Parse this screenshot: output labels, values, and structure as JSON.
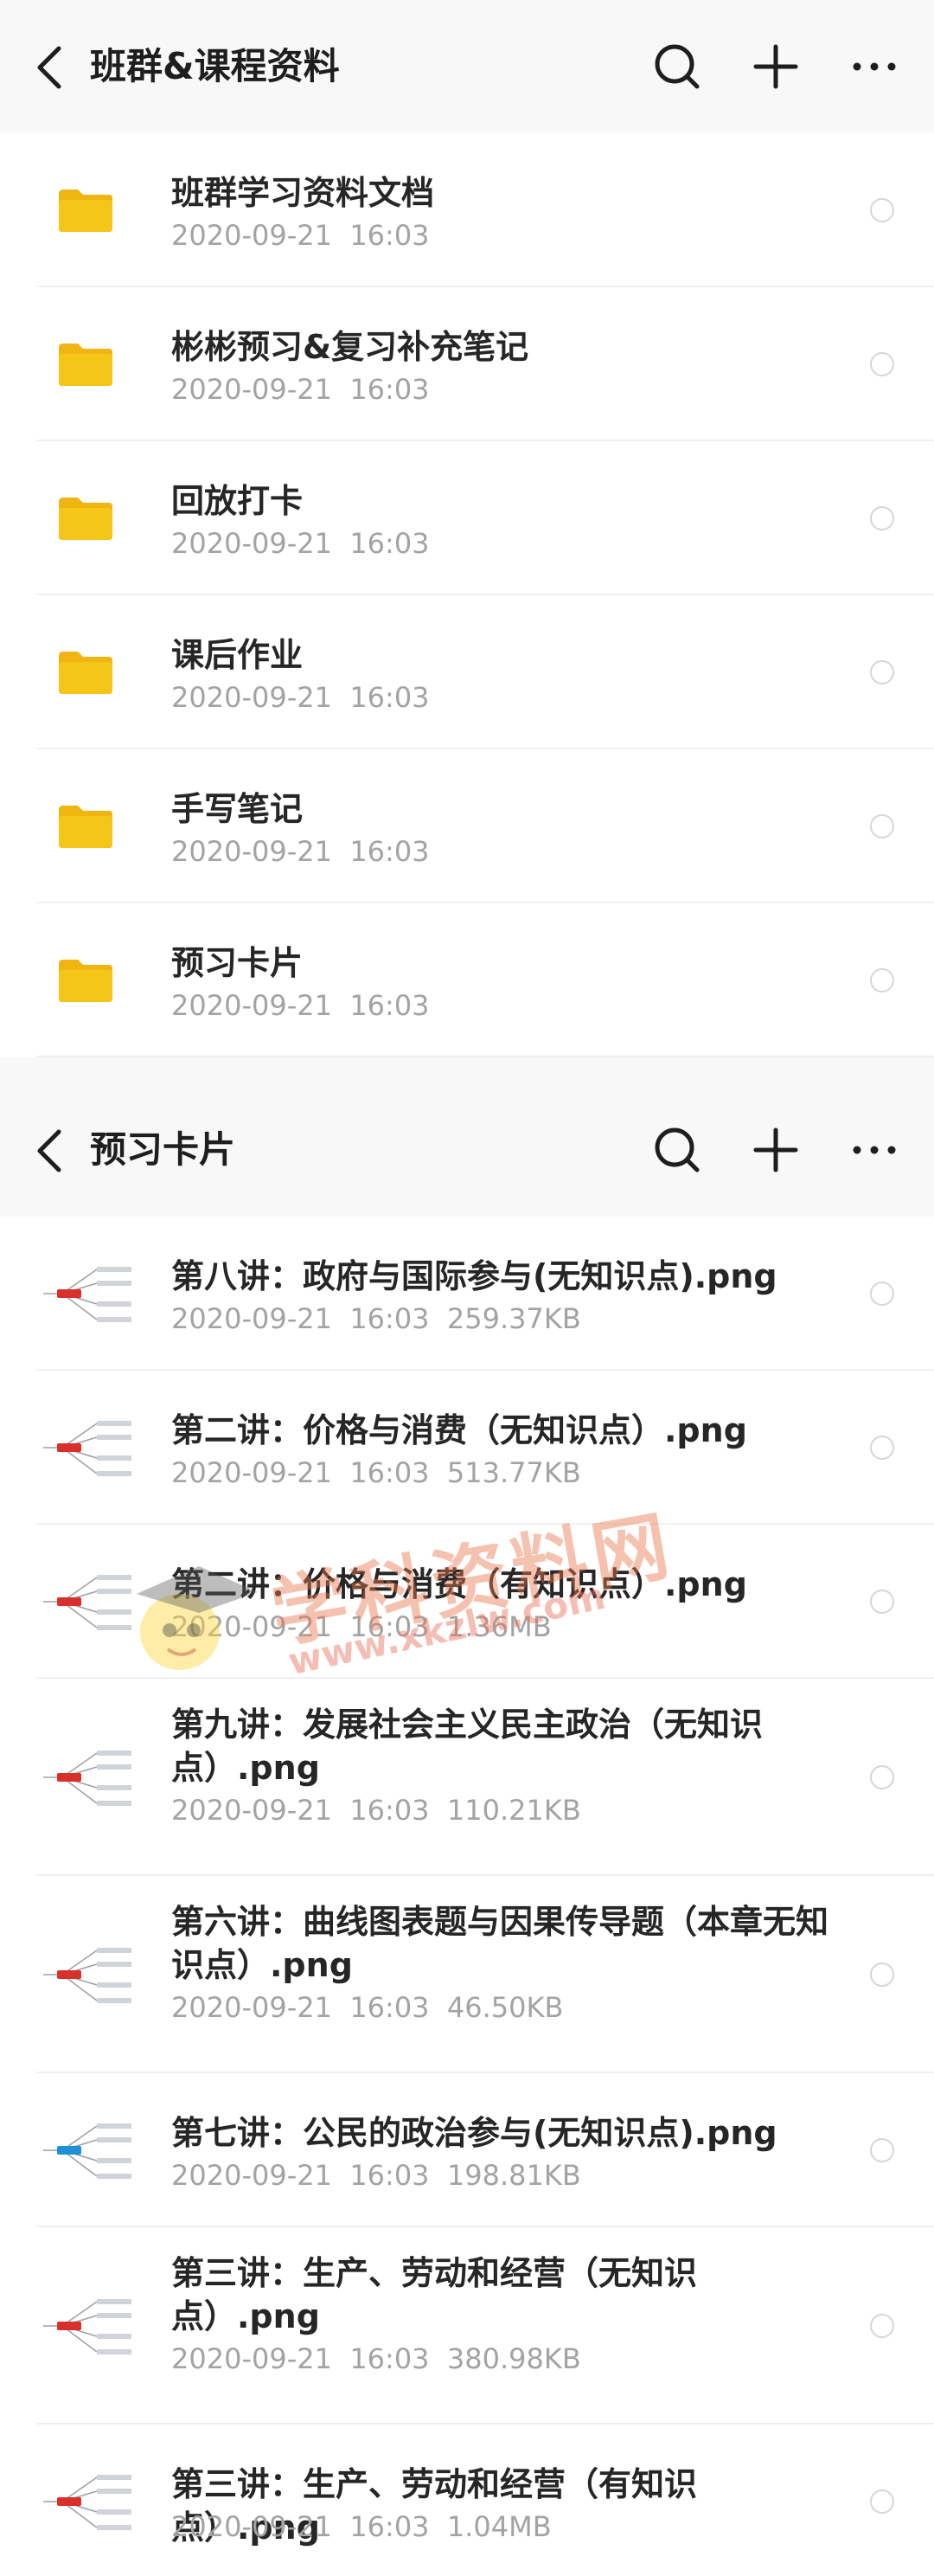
{
  "screen_top": {
    "title": "班群&课程资料",
    "items": [
      {
        "name": "班群学习资料文档",
        "date": "2020-09-21",
        "time": "16:03"
      },
      {
        "name": "彬彬预习&复习补充笔记",
        "date": "2020-09-21",
        "time": "16:03"
      },
      {
        "name": "回放打卡",
        "date": "2020-09-21",
        "time": "16:03"
      },
      {
        "name": "课后作业",
        "date": "2020-09-21",
        "time": "16:03"
      },
      {
        "name": "手写笔记",
        "date": "2020-09-21",
        "time": "16:03"
      },
      {
        "name": "预习卡片",
        "date": "2020-09-21",
        "time": "16:03"
      }
    ]
  },
  "screen_bottom": {
    "title": "预习卡片",
    "files": [
      {
        "name": "第八讲：政府与国际参与(无知识点).png",
        "date": "2020-09-21",
        "time": "16:03",
        "size": "259.37KB"
      },
      {
        "name": "第二讲：价格与消费（无知识点）.png",
        "date": "2020-09-21",
        "time": "16:03",
        "size": "513.77KB"
      },
      {
        "name": "第二讲：价格与消费（有知识点）.png",
        "date": "2020-09-21",
        "time": "16:03",
        "size": "1.36MB"
      },
      {
        "name": "第九讲：发展社会主义民主政治（无知识点）.png",
        "date": "2020-09-21",
        "time": "16:03",
        "size": "110.21KB"
      },
      {
        "name": "第六讲：曲线图表题与因果传导题（本章无知识点）.png",
        "date": "2020-09-21",
        "time": "16:03",
        "size": "46.50KB"
      },
      {
        "name": "第七讲：公民的政治参与(无知识点).png",
        "date": "2020-09-21",
        "time": "16:03",
        "size": "198.81KB"
      },
      {
        "name": "第三讲：生产、劳动和经营（无知识点）.png",
        "date": "2020-09-21",
        "time": "16:03",
        "size": "380.98KB"
      },
      {
        "name": "第三讲：生产、劳动和经营（有知识点）.png",
        "date": "2020-09-21",
        "time": "16:03",
        "size": "1.04MB"
      }
    ]
  },
  "watermark": {
    "text": "学科资料网",
    "url": "www.xkzlw.com"
  },
  "colors": {
    "folder": "#f5c518",
    "folder_tab": "#f0b510",
    "accent_red": "#d9302c",
    "text": "#262626",
    "meta": "#a3a3a3"
  },
  "icons": {
    "back": "chevron-left-icon",
    "search": "search-icon",
    "add": "plus-icon",
    "more": "more-dots-icon",
    "folder": "folder-icon",
    "thumb": "mindmap-thumbnail-icon"
  }
}
